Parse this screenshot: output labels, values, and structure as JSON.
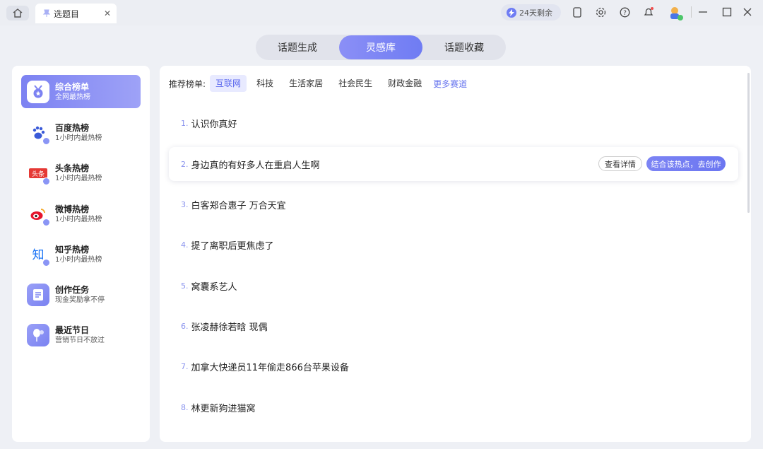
{
  "titlebar": {
    "tab_label": "选题目",
    "trial_label": "24天剩余",
    "icons": [
      "home-icon",
      "pin-icon",
      "close-icon",
      "bolt-icon",
      "mobile-icon",
      "settings-icon",
      "help-icon",
      "bell-icon",
      "avatar",
      "minimize-icon",
      "maximize-icon",
      "window-close-icon"
    ]
  },
  "segments": [
    {
      "label": "话题生成",
      "active": false
    },
    {
      "label": "灵感库",
      "active": true
    },
    {
      "label": "话题收藏",
      "active": false
    }
  ],
  "sidebar": {
    "items": [
      {
        "title": "综合榜单",
        "sub": "全网最热榜",
        "active": true,
        "icon": "medal-icon"
      },
      {
        "title": "百度热榜",
        "sub": "1小时内最热榜",
        "icon": "baidu-icon"
      },
      {
        "title": "头条热榜",
        "sub": "1小时内最热榜",
        "icon": "toutiao-icon"
      },
      {
        "title": "微博热榜",
        "sub": "1小时内最热榜",
        "icon": "weibo-icon"
      },
      {
        "title": "知乎热榜",
        "sub": "1小时内最热榜",
        "icon": "zhihu-icon"
      },
      {
        "title": "创作任务",
        "sub": "现金奖励拿不停",
        "icon": "task-icon"
      },
      {
        "title": "最近节日",
        "sub": "营销节日不放过",
        "icon": "festival-icon"
      }
    ]
  },
  "filter": {
    "label": "推荐榜单:",
    "chips": [
      "互联网",
      "科技",
      "生活家居",
      "社会民生",
      "财政金融"
    ],
    "active": "互联网",
    "more": "更多赛道"
  },
  "list": [
    {
      "num": "1.",
      "text": "认识你真好"
    },
    {
      "num": "2.",
      "text": "身边真的有好多人在重启人生啊"
    },
    {
      "num": "3.",
      "text": "白客郑合惠子 万合天宜"
    },
    {
      "num": "4.",
      "text": "提了离职后更焦虑了"
    },
    {
      "num": "5.",
      "text": "窝囊系艺人"
    },
    {
      "num": "6.",
      "text": "张凌赫徐若晗 现偶"
    },
    {
      "num": "7.",
      "text": "加拿大快递员11年偷走866台苹果设备"
    },
    {
      "num": "8.",
      "text": "林更新狗进猫窝"
    }
  ],
  "row_actions": {
    "detail": "查看详情",
    "create": "结合该热点，去创作"
  },
  "colors": {
    "accent": "#6f7cf3",
    "background": "#eef0f5"
  }
}
